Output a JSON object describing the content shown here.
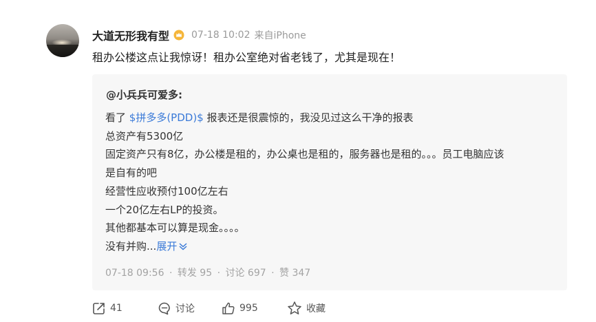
{
  "post": {
    "username": "大道无形我有型",
    "vip_badge_icon": "vip-crown-icon",
    "timestamp": "07-18 10:02",
    "source": "来自iPhone",
    "text": "租办公楼这点让我惊讶！租办公室绝对省老钱了，尤其是现在！"
  },
  "quote": {
    "author": "@小兵兵可爱多:",
    "line1_prefix": "看了 ",
    "line1_cashtag": "$拼多多(PDD)$",
    "line1_suffix": " 报表还是很震惊的，我没见过这么干净的报表",
    "lines": [
      "总资产有5300亿",
      "固定资产只有8亿，办公楼是租的，办公桌也是租的，服务器也是租的。。。员工电脑应该",
      "是自有的吧",
      "经营性应收预付100亿左右",
      "一个20亿左右LP的投资。",
      "其他都基本可以算是现金。。。。"
    ],
    "last_line_prefix": "没有并购...",
    "expand_label": "展开",
    "meta": {
      "time": "07-18 09:56",
      "separator": "·",
      "repost": "转发 95",
      "comment": "讨论 697",
      "like": "赞 347"
    }
  },
  "actions": {
    "repost_count": "41",
    "comment_label": "讨论",
    "like_count": "995",
    "favorite_label": "收藏"
  },
  "colors": {
    "link_blue": "#3a7ad8",
    "meta_gray": "#9a9a9a",
    "quote_bg": "#f7f7f7",
    "badge_gold": "#f5b63a"
  }
}
